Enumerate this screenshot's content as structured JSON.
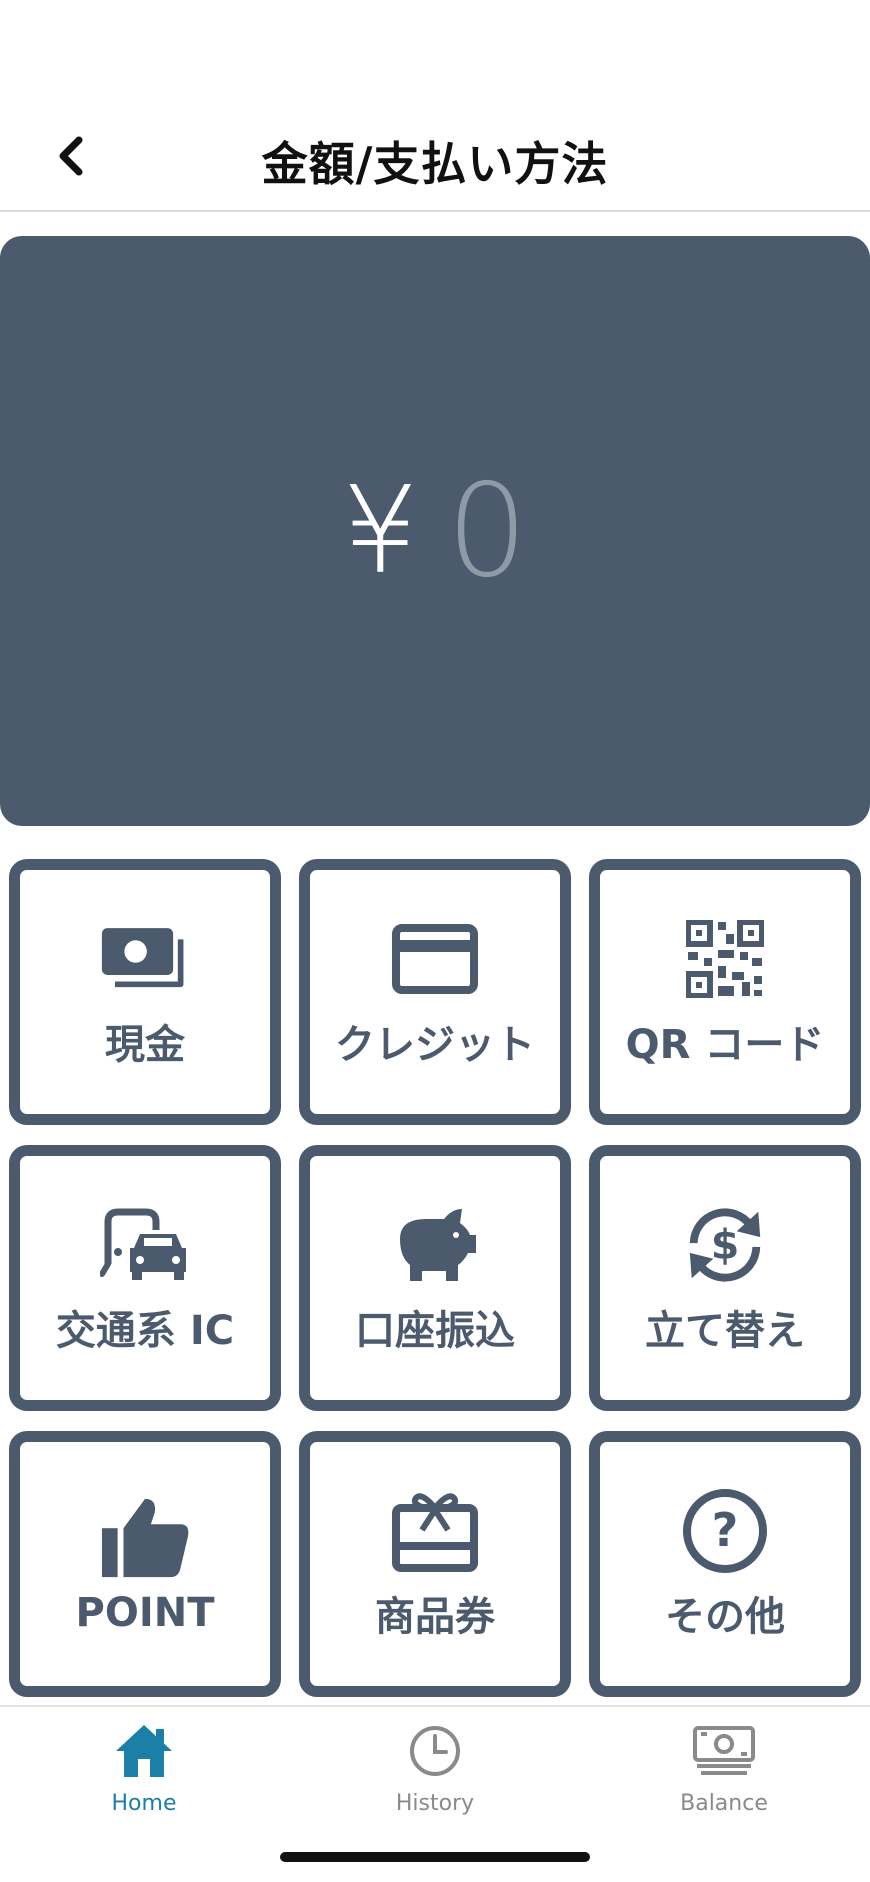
{
  "header": {
    "title": "金額/支払い方法",
    "back_icon": "chevron-left-icon"
  },
  "amount": {
    "currency_symbol": "¥",
    "value": "0"
  },
  "payment_methods": [
    {
      "label": "現金",
      "icon": "cash-icon"
    },
    {
      "label": "クレジット",
      "icon": "credit-card-icon"
    },
    {
      "label": "QR コード",
      "icon": "qr-code-icon"
    },
    {
      "label": "交通系 IC",
      "icon": "transit-icon"
    },
    {
      "label": "口座振込",
      "icon": "piggy-bank-icon"
    },
    {
      "label": "立て替え",
      "icon": "exchange-icon"
    },
    {
      "label": "POINT",
      "icon": "thumbs-up-icon"
    },
    {
      "label": "商品券",
      "icon": "gift-card-icon"
    },
    {
      "label": "その他",
      "icon": "question-icon"
    }
  ],
  "tabbar": {
    "items": [
      {
        "label": "Home",
        "icon": "home-icon",
        "active": true
      },
      {
        "label": "History",
        "icon": "clock-icon",
        "active": false
      },
      {
        "label": "Balance",
        "icon": "banknote-icon",
        "active": false
      }
    ]
  },
  "colors": {
    "panel": "#4b5b6d",
    "amount_placeholder": "#8d9aa8",
    "tab_active": "#1b7fa8",
    "tab_inactive": "#8a8a8a"
  }
}
